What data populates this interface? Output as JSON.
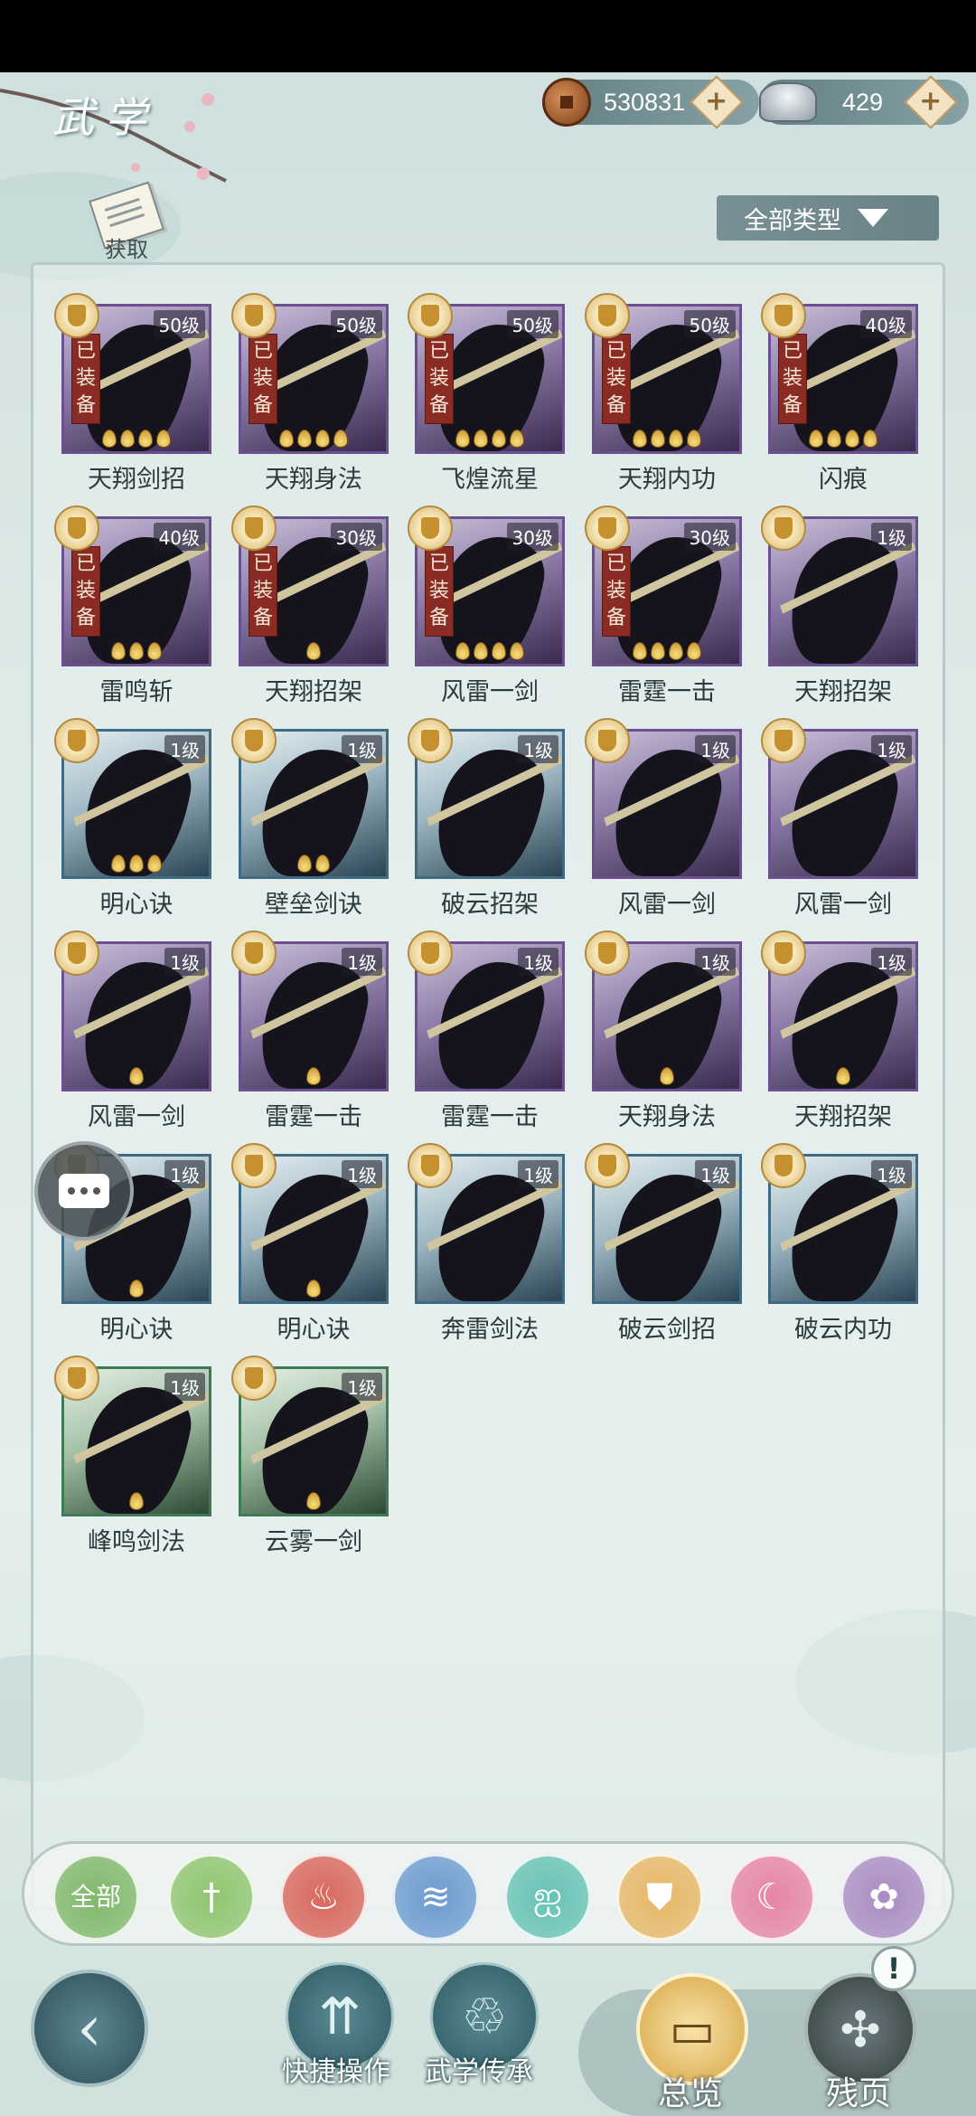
{
  "header": {
    "title": "武学",
    "copper": "530831",
    "silver": "429"
  },
  "acquire_label": "获取",
  "filter": {
    "label": "全部类型"
  },
  "skills": [
    {
      "name": "天翔剑招",
      "level": "50级",
      "equipped": true,
      "rarity": "purple",
      "stars": 4
    },
    {
      "name": "天翔身法",
      "level": "50级",
      "equipped": true,
      "rarity": "purple",
      "stars": 4
    },
    {
      "name": "飞煌流星",
      "level": "50级",
      "equipped": true,
      "rarity": "purple",
      "stars": 4
    },
    {
      "name": "天翔内功",
      "level": "50级",
      "equipped": true,
      "rarity": "purple",
      "stars": 4
    },
    {
      "name": "闪痕",
      "level": "40级",
      "equipped": true,
      "rarity": "purple",
      "stars": 4
    },
    {
      "name": "雷鸣斩",
      "level": "40级",
      "equipped": true,
      "rarity": "purple",
      "stars": 3
    },
    {
      "name": "天翔招架",
      "level": "30级",
      "equipped": true,
      "rarity": "purple",
      "stars": 1
    },
    {
      "name": "风雷一剑",
      "level": "30级",
      "equipped": true,
      "rarity": "purple",
      "stars": 4
    },
    {
      "name": "雷霆一击",
      "level": "30级",
      "equipped": true,
      "rarity": "purple",
      "stars": 4
    },
    {
      "name": "天翔招架",
      "level": "1级",
      "equipped": false,
      "rarity": "purple",
      "stars": 0
    },
    {
      "name": "明心诀",
      "level": "1级",
      "equipped": false,
      "rarity": "blue",
      "stars": 3
    },
    {
      "name": "壁垒剑诀",
      "level": "1级",
      "equipped": false,
      "rarity": "blue",
      "stars": 2
    },
    {
      "name": "破云招架",
      "level": "1级",
      "equipped": false,
      "rarity": "blue",
      "stars": 0
    },
    {
      "name": "风雷一剑",
      "level": "1级",
      "equipped": false,
      "rarity": "purple",
      "stars": 0
    },
    {
      "name": "风雷一剑",
      "level": "1级",
      "equipped": false,
      "rarity": "purple",
      "stars": 0
    },
    {
      "name": "风雷一剑",
      "level": "1级",
      "equipped": false,
      "rarity": "purple",
      "stars": 1
    },
    {
      "name": "雷霆一击",
      "level": "1级",
      "equipped": false,
      "rarity": "purple",
      "stars": 1
    },
    {
      "name": "雷霆一击",
      "level": "1级",
      "equipped": false,
      "rarity": "purple",
      "stars": 0
    },
    {
      "name": "天翔身法",
      "level": "1级",
      "equipped": false,
      "rarity": "purple",
      "stars": 1
    },
    {
      "name": "天翔招架",
      "level": "1级",
      "equipped": false,
      "rarity": "purple",
      "stars": 1
    },
    {
      "name": "明心诀",
      "level": "1级",
      "equipped": false,
      "rarity": "blue",
      "stars": 1
    },
    {
      "name": "明心诀",
      "level": "1级",
      "equipped": false,
      "rarity": "blue",
      "stars": 1
    },
    {
      "name": "奔雷剑法",
      "level": "1级",
      "equipped": false,
      "rarity": "blue",
      "stars": 0
    },
    {
      "name": "破云剑招",
      "level": "1级",
      "equipped": false,
      "rarity": "blue",
      "stars": 0
    },
    {
      "name": "破云内功",
      "level": "1级",
      "equipped": false,
      "rarity": "blue",
      "stars": 0
    },
    {
      "name": "峰鸣剑法",
      "level": "1级",
      "equipped": false,
      "rarity": "green",
      "stars": 1
    },
    {
      "name": "云雾一剑",
      "level": "1级",
      "equipped": false,
      "rarity": "green",
      "stars": 1
    }
  ],
  "equipped_label": "已装备",
  "categories": [
    {
      "id": "all",
      "label": "全部",
      "icon": "all-icon",
      "color": "#7fb86a"
    },
    {
      "id": "sword",
      "label": "",
      "icon": "sword-icon",
      "color": "#8ec56f"
    },
    {
      "id": "fire",
      "label": "",
      "icon": "flame-icon",
      "color": "#d8675c"
    },
    {
      "id": "water",
      "label": "",
      "icon": "wave-icon",
      "color": "#6b9bcf"
    },
    {
      "id": "butterfly",
      "label": "",
      "icon": "butterfly-icon",
      "color": "#66c2b4"
    },
    {
      "id": "shield",
      "label": "",
      "icon": "shield-icon",
      "color": "#e6b765"
    },
    {
      "id": "moon",
      "label": "",
      "icon": "moon-icon",
      "color": "#e684a6"
    },
    {
      "id": "rose",
      "label": "",
      "icon": "rose-icon",
      "color": "#a98cc2"
    }
  ],
  "nav": {
    "quick_ops": "快捷操作",
    "inherit": "武学传承",
    "overview": "总览",
    "fragments": "残页",
    "alert": "!"
  }
}
